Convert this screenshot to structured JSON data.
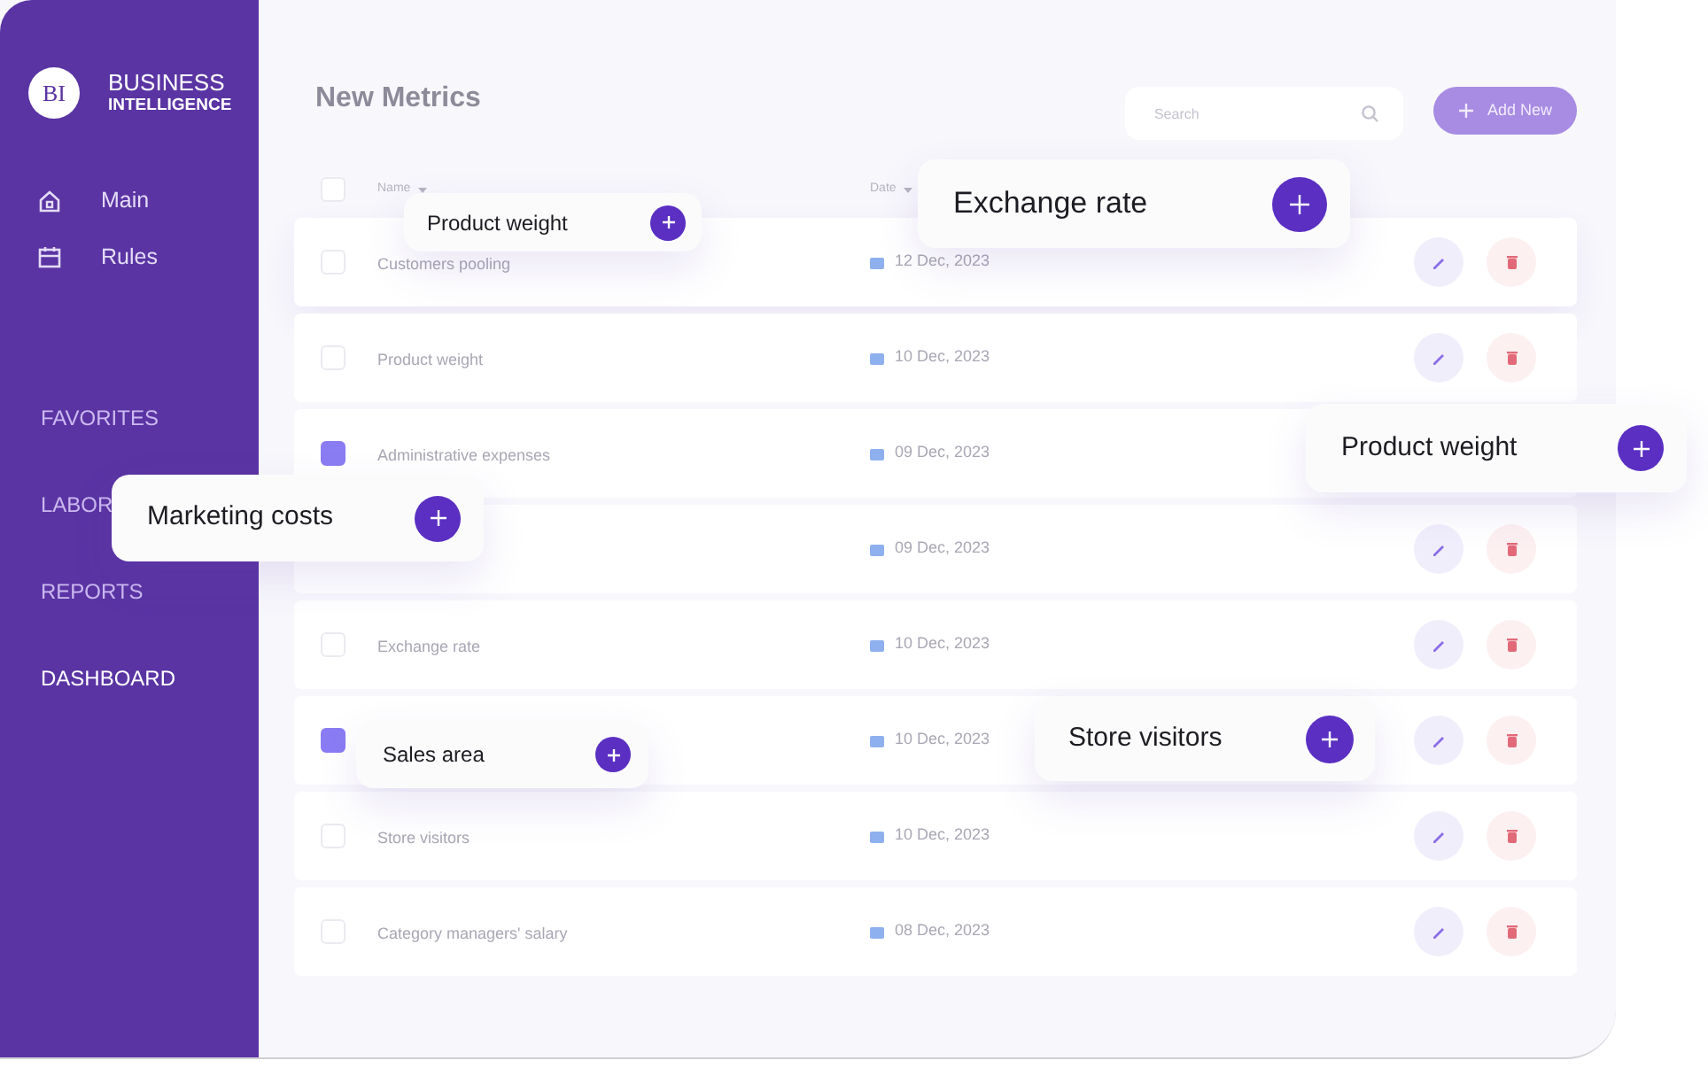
{
  "brand": {
    "logo": "BI",
    "title": "BUSINESS",
    "subtitle": "INTELLIGENCE"
  },
  "nav": [
    {
      "kind": "home",
      "label": "Main"
    },
    {
      "kind": "calendar",
      "label": "Rules"
    }
  ],
  "sections": [
    {
      "label": "FAVORITES",
      "selected": false
    },
    {
      "label": "LABOR",
      "selected": false
    },
    {
      "label": "REPORTS",
      "selected": false
    },
    {
      "label": "DASHBOARD",
      "selected": true
    }
  ],
  "page_title": "New Metrics",
  "search": {
    "placeholder": "Search"
  },
  "add_button": "Add New",
  "table": {
    "select_all": {
      "checked": false
    },
    "columns": [
      "Name",
      "Date"
    ],
    "rows": [
      {
        "name": "Customers pooling",
        "date": "12 Dec, 2023",
        "checked": false
      },
      {
        "name": "Product weight",
        "date": "10 Dec, 2023",
        "checked": false
      },
      {
        "name": "Administrative expenses",
        "date": "09 Dec, 2023",
        "checked": true
      },
      {
        "date": "09 Dec, 2023"
      },
      {
        "name": "Exchange rate",
        "date": "10 Dec, 2023",
        "checked": false
      },
      {
        "date": "10 Dec, 2023",
        "checked": true
      },
      {
        "name": "Store visitors",
        "date": "10 Dec, 2023",
        "checked": false
      },
      {
        "name": "Category managers' salary",
        "date": "08 Dec, 2023",
        "checked": false
      }
    ]
  },
  "floating_cards": [
    {
      "label": "Product weight"
    },
    {
      "label": "Exchange rate"
    },
    {
      "label": "Product weight"
    },
    {
      "label": "Marketing costs"
    },
    {
      "label": "Sales area"
    },
    {
      "label": "Store visitors"
    }
  ]
}
